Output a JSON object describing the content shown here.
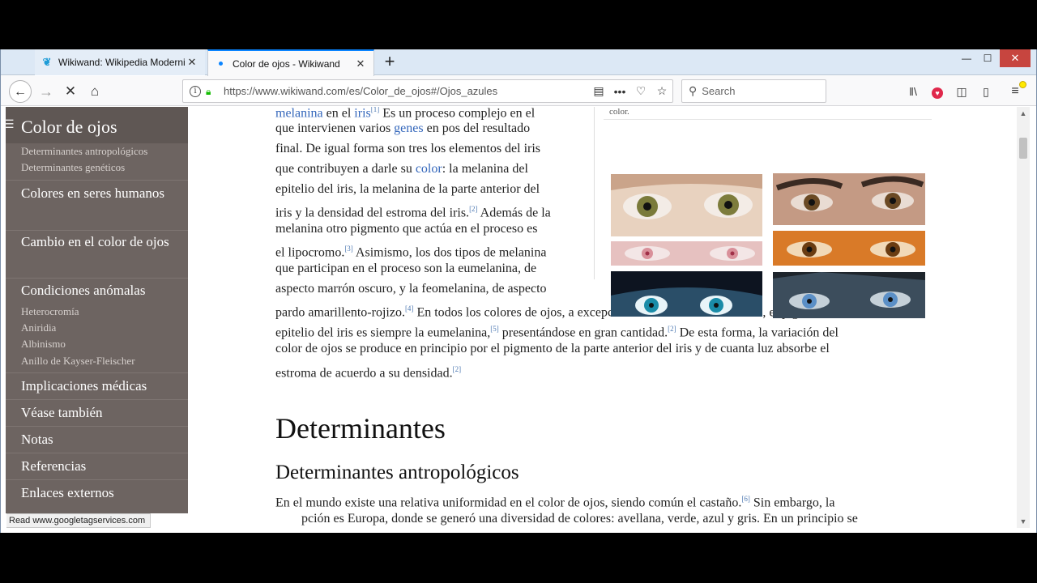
{
  "tabs": [
    {
      "title": "Wikiwand: Wikipedia Moderniz",
      "close": "✕",
      "active": false
    },
    {
      "title": "Color de ojos - Wikiwand",
      "close": "✕",
      "active": true
    }
  ],
  "newtab_symbol": "+",
  "window_controls": {
    "minimize": "—",
    "maximize": "☐",
    "close": "✕"
  },
  "nav": {
    "back": "←",
    "forward": "→",
    "stop": "✕",
    "home": "⌂"
  },
  "url": "https://www.wikiwand.com/es/Color_de_ojos#/Ojos_azules",
  "url_actions": {
    "reader": "▤",
    "more": "•••",
    "pocket": "♡",
    "bookmark": "☆"
  },
  "search": {
    "placeholder": "Search"
  },
  "toolbar_icons": {
    "library": "‖\\",
    "pocket_save": "♥",
    "sidebar": "◫",
    "screenshot": "▯",
    "menu": "≡"
  },
  "toc": {
    "menu_icon": "☰",
    "title": "Color de ojos",
    "sub_top": [
      "Determinantes antropológicos",
      "Determinantes genéticos"
    ],
    "items": [
      {
        "label": "Colores en seres humanos"
      },
      {
        "label": "Cambio en el color de ojos"
      },
      {
        "label": "Condiciones anómalas"
      },
      {
        "label": "Implicaciones médicas"
      },
      {
        "label": "Véase también"
      },
      {
        "label": "Notas"
      },
      {
        "label": "Referencias"
      },
      {
        "label": "Enlaces externos"
      }
    ],
    "sub_anomalas": [
      "Heterocromía",
      "Aniridia",
      "Albinismo",
      "Anillo de Kayser-Fleischer"
    ]
  },
  "article": {
    "p1": {
      "l1a": "melanina",
      "l1b": " en el ",
      "l1c": "iris",
      "l1r": "[1]",
      "l1d": " Es un proceso complejo en el",
      "l2a": "que intervienen varios ",
      "l2b": "genes",
      "l2c": " en pos del resultado",
      "l3": "final. De igual forma son tres los elementos del iris",
      "l4a": "que contribuyen a darle su ",
      "l4b": "color",
      "l4c": ": la melanina del",
      "l5": "epitelio del iris, la melanina de la parte anterior del",
      "l6a": "iris y la densidad del estroma del iris.",
      "l6r": "[2]",
      "l6b": " Además de la",
      "l7": "melanina otro pigmento que actúa en el proceso es",
      "l8a": "el lipocromo.",
      "l8r": "[3]",
      "l8b": " Asimismo, los dos tipos de melanina",
      "l9": "que participan en el proceso son la eumelanina, de",
      "l10": "aspecto marrón oscuro, y la feomelanina, de aspecto",
      "l11a": "pardo amarillento-rojizo.",
      "l11r": "[4]",
      "l11b": " En todos los colores de ojos, a excepción de condiciones anómalas, el pigmento del",
      "l12a": "epitelio del iris es siempre la eumelanina,",
      "l12r": "[5]",
      "l12b": " presentándose en gran cantidad.",
      "l12r2": "[2]",
      "l12c": " De esta forma, la variación del",
      "l13": "color de ojos se produce en principio por el pigmento de la parte anterior del iris y de cuanta luz absorbe el",
      "l14a": "estroma de acuerdo a su densidad.",
      "l14r": "[2]"
    },
    "h2": "Determinantes",
    "h3": "Determinantes antropológicos",
    "p2": {
      "l1a": "En el mundo existe una relativa uniformidad en el color de ojos, siendo común el castaño.",
      "l1r": "[6]",
      "l1b": " Sin embargo, la",
      "l2": "pción es Europa, donde se generó una diversidad de colores: avellana, verde, azul y gris. En un principio se"
    },
    "figure_caption": "color."
  },
  "status_text": "Read www.googletagservices.com",
  "scroll": {
    "up": "▲",
    "down": "▼"
  },
  "colors": {
    "toc_bg": "#6d6461",
    "link": "#3366bb",
    "tab_accent": "#0a84ff",
    "close_red": "#c7453f"
  }
}
